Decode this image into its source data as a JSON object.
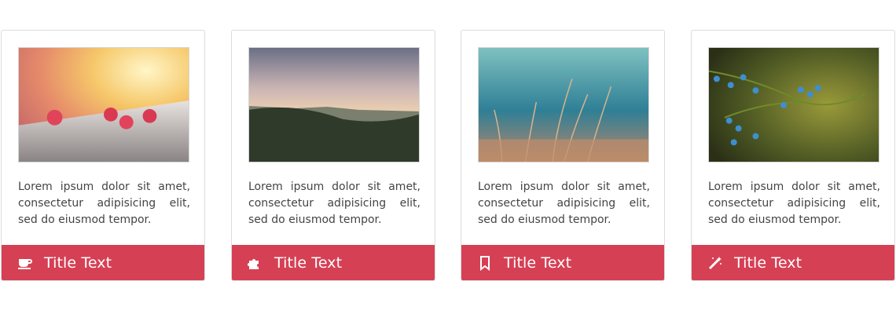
{
  "cards": [
    {
      "image": "raspberries-photo",
      "text": "Lorem ipsum dolor sit amet, consectetur adipisicing elit, sed do eiusmod tempor.",
      "icon": "coffee-cup-icon",
      "title": "Title Text"
    },
    {
      "image": "landscape-valley-photo",
      "text": "Lorem ipsum dolor sit amet, consectetur adipisicing elit, sed do eiusmod tempor.",
      "icon": "puzzle-piece-icon",
      "title": "Title Text"
    },
    {
      "image": "wheat-grass-photo",
      "text": "Lorem ipsum dolor sit amet, consectetur adipisicing elit, sed do eiusmod tempor.",
      "icon": "bookmark-icon",
      "title": "Title Text"
    },
    {
      "image": "juniper-berries-photo",
      "text": "Lorem ipsum dolor sit amet, consectetur adipisicing elit, sed do eiusmod tempor.",
      "icon": "magic-wand-icon",
      "title": "Title Text"
    }
  ],
  "colors": {
    "footer": "#d64054",
    "text": "#444444",
    "border": "#dcdcdc"
  }
}
